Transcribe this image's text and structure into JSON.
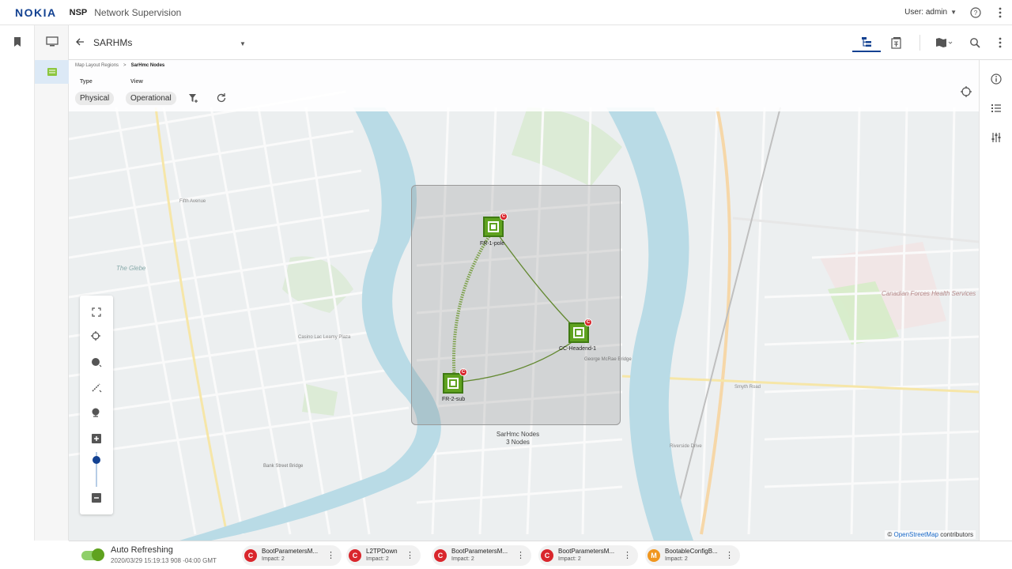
{
  "header": {
    "logo": "NOKIA",
    "app_name": "NSP",
    "app_description": "Network Supervision",
    "user_label": "User: admin",
    "help_icon": "help-circle-icon",
    "more_icon": "vertical-dots-icon"
  },
  "left_rail": {
    "items": [
      {
        "icon": "bookmark-icon"
      },
      {
        "icon": "monitor-icon"
      },
      {
        "icon": "map-view-icon",
        "active": true
      }
    ]
  },
  "toolbar": {
    "back_icon": "arrow-left-icon",
    "view_title": "SARHMs",
    "buttons": [
      "hierarchy-icon",
      "device-list-icon",
      "map-layers-icon",
      "search-icon",
      "vertical-dots-icon"
    ]
  },
  "right_rail": {
    "items": [
      "info-icon",
      "list-icon",
      "sliders-icon"
    ]
  },
  "map": {
    "breadcrumb": [
      "Map Layout Regions",
      "SarHmc Nodes"
    ],
    "breadcrumb_separator": ">",
    "type_label": "Type",
    "view_label": "View",
    "type_value": "Physical",
    "view_value": "Operational",
    "group_name": "SarHmc Nodes",
    "group_count": "3 Nodes",
    "nodes": [
      {
        "label": "FR-1-pole",
        "badge": "C"
      },
      {
        "label": "CC-Headend-1",
        "badge": "C"
      },
      {
        "label": "FR-2-sub",
        "badge": "C"
      }
    ],
    "attribution_prefix": "©",
    "attribution_link": "OpenStreetMap",
    "attribution_suffix": "contributors",
    "labels": {
      "glebe": "The Glebe",
      "cfhs": "Canadian Forces Health Services",
      "fifth": "Fifth Avenue",
      "mcrae": "George McRae Bridge",
      "smyth": "Smyth Road",
      "bank": "Bank Street Bridge",
      "riverside": "Riverside Drive",
      "casino": "Casino Lac Leamy Plaza"
    }
  },
  "status": {
    "auto_label": "Auto Refreshing",
    "auto_time": "2020/03/29 15:19:13 908 -04:00 GMT",
    "alarms": [
      {
        "badge": "C",
        "name": "BootParametersM...",
        "impact": "Impact: 2",
        "color": "#d9262c"
      },
      {
        "badge": "C",
        "name": "L2TPDown",
        "impact": "Impact: 2",
        "color": "#d9262c"
      },
      {
        "badge": "C",
        "name": "BootParametersM...",
        "impact": "Impact: 2",
        "color": "#d9262c"
      },
      {
        "badge": "C",
        "name": "BootParametersM...",
        "impact": "Impact: 2",
        "color": "#d9262c"
      },
      {
        "badge": "M",
        "name": "BootableConfigB...",
        "impact": "Impact: 2",
        "color": "#f0961e"
      }
    ]
  },
  "colors": {
    "brand": "#124191",
    "node_green": "#5fa21f",
    "critical": "#d9262c",
    "major": "#f0961e",
    "river": "#b9dbe6"
  }
}
